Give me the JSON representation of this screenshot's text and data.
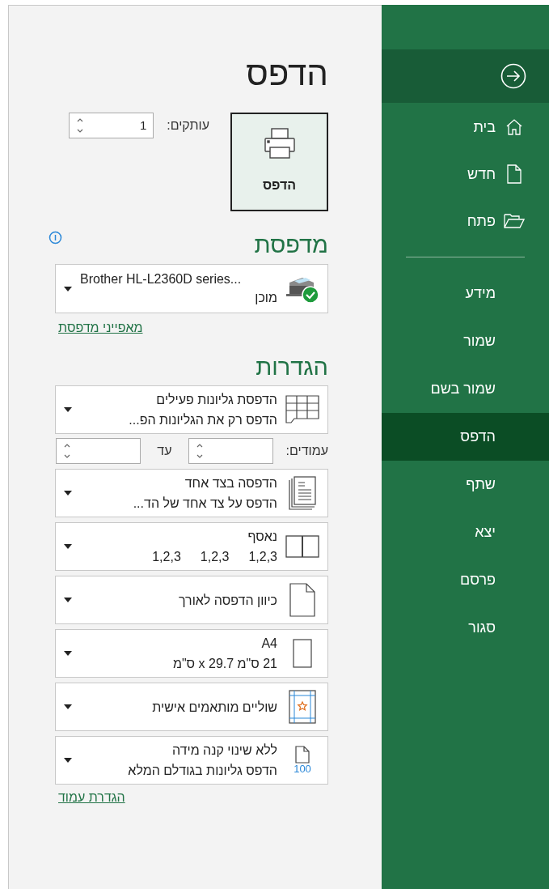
{
  "sidebar": {
    "back_button": {
      "kind": "back"
    },
    "top_items": [
      {
        "label": "בית",
        "kind": "home",
        "selected": false
      },
      {
        "label": "חדש",
        "kind": "new",
        "selected": false
      },
      {
        "label": "פתח",
        "kind": "open",
        "selected": false
      }
    ],
    "bottom_items": [
      {
        "label": "מידע",
        "selected": false
      },
      {
        "label": "שמור",
        "selected": false
      },
      {
        "label": "שמור בשם",
        "selected": false
      },
      {
        "label": "הדפס",
        "selected": true
      },
      {
        "label": "שתף",
        "selected": false
      },
      {
        "label": "יצא",
        "selected": false
      },
      {
        "label": "פרסם",
        "selected": false
      },
      {
        "label": "סגור",
        "selected": false
      }
    ]
  },
  "title": "הדפס",
  "print_button": {
    "label": "הדפס"
  },
  "copies": {
    "label": "עותקים:",
    "value": "1"
  },
  "printer": {
    "heading": "מדפסת",
    "name": "Brother HL-L2360D series...",
    "status": "מוכן",
    "link": "מאפייני מדפסת"
  },
  "settings": {
    "heading": "הגדרות",
    "items": [
      {
        "kind": "sheets",
        "title": "הדפסת גליונות פעילים",
        "subtitle": "הדפס רק את הגליונות הפ..."
      },
      {
        "kind": "pages",
        "label": "עמודים:",
        "to_label": "עד"
      },
      {
        "kind": "one-sided",
        "title": "הדפסה בצד אחד",
        "subtitle": "הדפס על צד אחד של הד..."
      },
      {
        "kind": "collate",
        "title": "נאסף",
        "subtitle_parts": [
          "1,2,3",
          "1,2,3",
          "1,2,3"
        ]
      },
      {
        "kind": "portrait",
        "title": "כיוון הדפסה לאורך"
      },
      {
        "kind": "paper",
        "title": "A4",
        "subtitle": "21 ס\"מ x 29.7 ס\"מ"
      },
      {
        "kind": "margins",
        "title": "שוליים מותאמים אישית"
      },
      {
        "kind": "scaling",
        "icon_text": "100",
        "title": "ללא שינוי קנה מידה",
        "subtitle": "הדפס גליונות בגודלם המלא"
      }
    ],
    "link": "הגדרת עמוד"
  }
}
